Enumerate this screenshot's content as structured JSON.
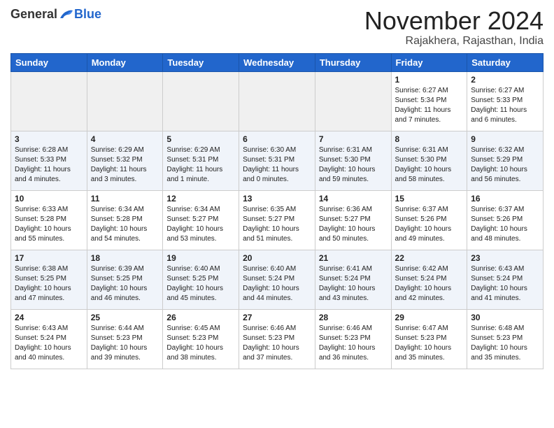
{
  "header": {
    "logo": {
      "general": "General",
      "blue": "Blue"
    },
    "title": "November 2024",
    "location": "Rajakhera, Rajasthan, India"
  },
  "weekdays": [
    "Sunday",
    "Monday",
    "Tuesday",
    "Wednesday",
    "Thursday",
    "Friday",
    "Saturday"
  ],
  "weeks": [
    {
      "row_class": "row-odd",
      "days": [
        {
          "num": "",
          "info": "",
          "empty": true
        },
        {
          "num": "",
          "info": "",
          "empty": true
        },
        {
          "num": "",
          "info": "",
          "empty": true
        },
        {
          "num": "",
          "info": "",
          "empty": true
        },
        {
          "num": "",
          "info": "",
          "empty": true
        },
        {
          "num": "1",
          "info": "Sunrise: 6:27 AM\nSunset: 5:34 PM\nDaylight: 11 hours\nand 7 minutes."
        },
        {
          "num": "2",
          "info": "Sunrise: 6:27 AM\nSunset: 5:33 PM\nDaylight: 11 hours\nand 6 minutes."
        }
      ]
    },
    {
      "row_class": "row-even",
      "days": [
        {
          "num": "3",
          "info": "Sunrise: 6:28 AM\nSunset: 5:33 PM\nDaylight: 11 hours\nand 4 minutes."
        },
        {
          "num": "4",
          "info": "Sunrise: 6:29 AM\nSunset: 5:32 PM\nDaylight: 11 hours\nand 3 minutes."
        },
        {
          "num": "5",
          "info": "Sunrise: 6:29 AM\nSunset: 5:31 PM\nDaylight: 11 hours\nand 1 minute."
        },
        {
          "num": "6",
          "info": "Sunrise: 6:30 AM\nSunset: 5:31 PM\nDaylight: 11 hours\nand 0 minutes."
        },
        {
          "num": "7",
          "info": "Sunrise: 6:31 AM\nSunset: 5:30 PM\nDaylight: 10 hours\nand 59 minutes."
        },
        {
          "num": "8",
          "info": "Sunrise: 6:31 AM\nSunset: 5:30 PM\nDaylight: 10 hours\nand 58 minutes."
        },
        {
          "num": "9",
          "info": "Sunrise: 6:32 AM\nSunset: 5:29 PM\nDaylight: 10 hours\nand 56 minutes."
        }
      ]
    },
    {
      "row_class": "row-odd",
      "days": [
        {
          "num": "10",
          "info": "Sunrise: 6:33 AM\nSunset: 5:28 PM\nDaylight: 10 hours\nand 55 minutes."
        },
        {
          "num": "11",
          "info": "Sunrise: 6:34 AM\nSunset: 5:28 PM\nDaylight: 10 hours\nand 54 minutes."
        },
        {
          "num": "12",
          "info": "Sunrise: 6:34 AM\nSunset: 5:27 PM\nDaylight: 10 hours\nand 53 minutes."
        },
        {
          "num": "13",
          "info": "Sunrise: 6:35 AM\nSunset: 5:27 PM\nDaylight: 10 hours\nand 51 minutes."
        },
        {
          "num": "14",
          "info": "Sunrise: 6:36 AM\nSunset: 5:27 PM\nDaylight: 10 hours\nand 50 minutes."
        },
        {
          "num": "15",
          "info": "Sunrise: 6:37 AM\nSunset: 5:26 PM\nDaylight: 10 hours\nand 49 minutes."
        },
        {
          "num": "16",
          "info": "Sunrise: 6:37 AM\nSunset: 5:26 PM\nDaylight: 10 hours\nand 48 minutes."
        }
      ]
    },
    {
      "row_class": "row-even",
      "days": [
        {
          "num": "17",
          "info": "Sunrise: 6:38 AM\nSunset: 5:25 PM\nDaylight: 10 hours\nand 47 minutes."
        },
        {
          "num": "18",
          "info": "Sunrise: 6:39 AM\nSunset: 5:25 PM\nDaylight: 10 hours\nand 46 minutes."
        },
        {
          "num": "19",
          "info": "Sunrise: 6:40 AM\nSunset: 5:25 PM\nDaylight: 10 hours\nand 45 minutes."
        },
        {
          "num": "20",
          "info": "Sunrise: 6:40 AM\nSunset: 5:24 PM\nDaylight: 10 hours\nand 44 minutes."
        },
        {
          "num": "21",
          "info": "Sunrise: 6:41 AM\nSunset: 5:24 PM\nDaylight: 10 hours\nand 43 minutes."
        },
        {
          "num": "22",
          "info": "Sunrise: 6:42 AM\nSunset: 5:24 PM\nDaylight: 10 hours\nand 42 minutes."
        },
        {
          "num": "23",
          "info": "Sunrise: 6:43 AM\nSunset: 5:24 PM\nDaylight: 10 hours\nand 41 minutes."
        }
      ]
    },
    {
      "row_class": "row-odd",
      "days": [
        {
          "num": "24",
          "info": "Sunrise: 6:43 AM\nSunset: 5:24 PM\nDaylight: 10 hours\nand 40 minutes."
        },
        {
          "num": "25",
          "info": "Sunrise: 6:44 AM\nSunset: 5:23 PM\nDaylight: 10 hours\nand 39 minutes."
        },
        {
          "num": "26",
          "info": "Sunrise: 6:45 AM\nSunset: 5:23 PM\nDaylight: 10 hours\nand 38 minutes."
        },
        {
          "num": "27",
          "info": "Sunrise: 6:46 AM\nSunset: 5:23 PM\nDaylight: 10 hours\nand 37 minutes."
        },
        {
          "num": "28",
          "info": "Sunrise: 6:46 AM\nSunset: 5:23 PM\nDaylight: 10 hours\nand 36 minutes."
        },
        {
          "num": "29",
          "info": "Sunrise: 6:47 AM\nSunset: 5:23 PM\nDaylight: 10 hours\nand 35 minutes."
        },
        {
          "num": "30",
          "info": "Sunrise: 6:48 AM\nSunset: 5:23 PM\nDaylight: 10 hours\nand 35 minutes."
        }
      ]
    }
  ]
}
